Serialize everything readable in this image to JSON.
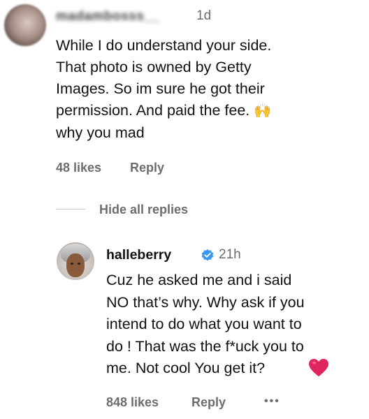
{
  "comment": {
    "username": "madambosss__",
    "time": "1d",
    "text": "While I do understand your side.\nThat photo is owned by Getty\nImages. So im sure he got their\npermission. And paid the fee.",
    "text_tail": "why you mad",
    "emoji": "🙌",
    "likes": "48 likes",
    "reply": "Reply"
  },
  "thread": {
    "hide_replies": "Hide all replies"
  },
  "reply_comment": {
    "username": "halleberry",
    "time": "21h",
    "text": "Cuz he asked me and i said\nNO that’s why. Why ask if you\nintend to do what you want to\ndo ! That was the f*uck you to\nme. Not cool You get it?",
    "likes": "848 likes",
    "reply": "Reply",
    "more": "•••"
  },
  "colors": {
    "text": "#111111",
    "meta": "#6d6d6d",
    "verified": "#3897f0",
    "heart": "#e0245e"
  },
  "icons": [
    "avatar",
    "verified-badge-icon",
    "heart-emoji-icon",
    "raised-hands-emoji-icon",
    "more-options-icon"
  ]
}
